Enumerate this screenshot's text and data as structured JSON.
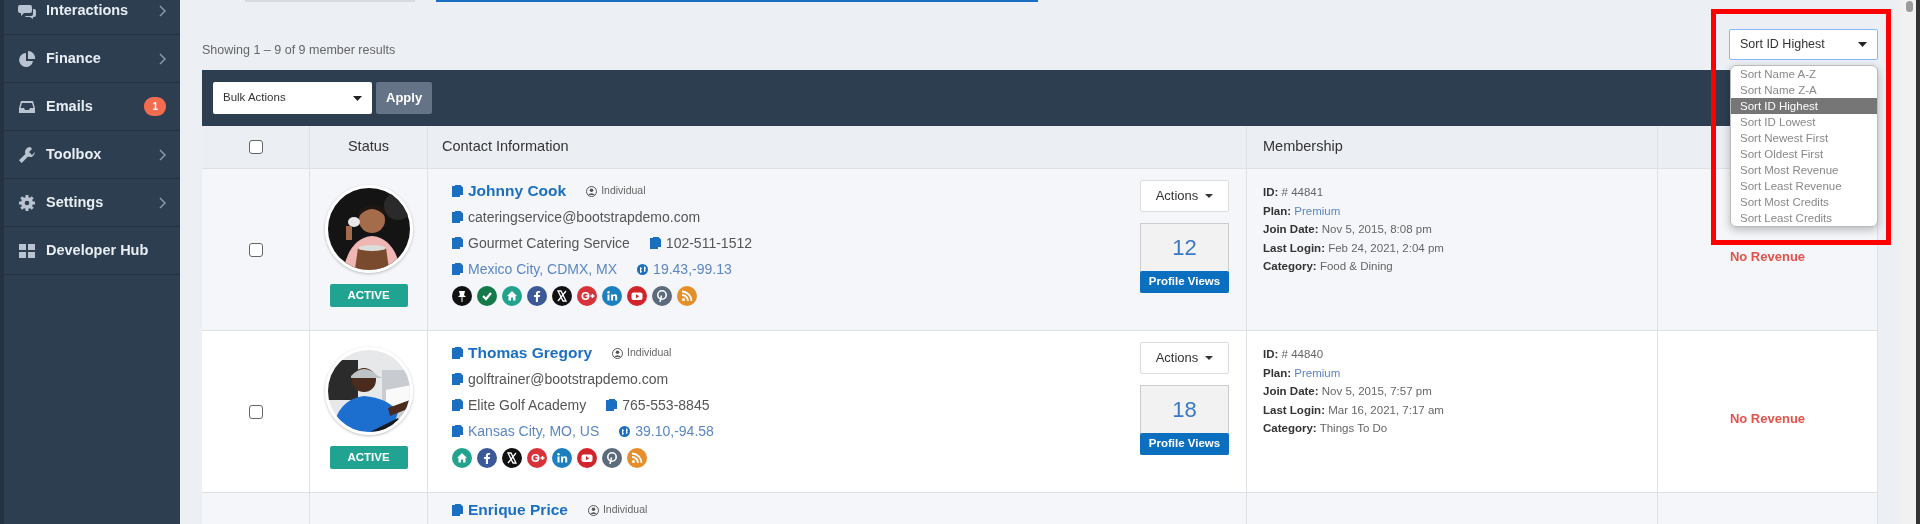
{
  "sidebar": {
    "items": [
      {
        "label": "Interactions",
        "kind": "chat",
        "submenu": true
      },
      {
        "label": "Finance",
        "kind": "pie",
        "submenu": true
      },
      {
        "label": "Emails",
        "kind": "inbox",
        "submenu": false,
        "badge": "1"
      },
      {
        "label": "Toolbox",
        "kind": "wrench",
        "submenu": true
      },
      {
        "label": "Settings",
        "kind": "gear",
        "submenu": true
      },
      {
        "label": "Developer Hub",
        "kind": "grid",
        "submenu": false
      }
    ]
  },
  "results_summary": "Showing 1 – 9 of 9 member results",
  "sort": {
    "value": "Sort ID Highest",
    "expanded": true,
    "options": [
      {
        "label": "Sort Name A-Z",
        "selected": false
      },
      {
        "label": "Sort Name Z-A",
        "selected": false
      },
      {
        "label": "Sort ID Highest",
        "selected": true
      },
      {
        "label": "Sort ID Lowest",
        "selected": false
      },
      {
        "label": "Sort Newest First",
        "selected": false
      },
      {
        "label": "Sort Oldest First",
        "selected": false
      },
      {
        "label": "Sort Most Revenue",
        "selected": false
      },
      {
        "label": "Sort Least Revenue",
        "selected": false
      },
      {
        "label": "Sort Most Credits",
        "selected": false
      },
      {
        "label": "Sort Least Credits",
        "selected": false
      }
    ]
  },
  "toolbar": {
    "bulk_actions": "Bulk Actions",
    "apply": "Apply"
  },
  "table": {
    "select_all": {
      "checked": false
    },
    "columns": [
      "Status",
      "Contact Information",
      "Membership"
    ],
    "rows": [
      {
        "selected": false,
        "status": "ACTIVE",
        "name": "Johnny Cook",
        "member_type": "Individual",
        "email": "cateringservice@bootstrapdemo.com",
        "company": "Gourmet Catering Service",
        "phone": "102-511-1512",
        "location": "Mexico City, CDMX, MX",
        "coordinates": "19.43,-99.13",
        "socials": [
          {
            "kind": "pin",
            "color": "#111111"
          },
          {
            "kind": "check",
            "color": "#157a4a"
          },
          {
            "kind": "home",
            "color": "#22a38d"
          },
          {
            "kind": "facebook",
            "color": "#3b5998"
          },
          {
            "kind": "x",
            "color": "#111111"
          },
          {
            "kind": "google",
            "color": "#d8333a"
          },
          {
            "kind": "linkedin",
            "color": "#1c7fc0"
          },
          {
            "kind": "youtube",
            "color": "#d4242b"
          },
          {
            "kind": "pinterest",
            "color": "#5b6b7c"
          },
          {
            "kind": "rss",
            "color": "#e58f2a"
          }
        ],
        "actions": "Actions",
        "profile_views": "12",
        "views_label": "Profile Views",
        "membership": [
          {
            "label": "ID:",
            "value": "# 44841",
            "kind": "plain"
          },
          {
            "label": "Plan:",
            "value": "Premium",
            "kind": "link"
          },
          {
            "label": "Join Date:",
            "value": "Nov 5, 2015, 8:08 pm",
            "kind": "plain"
          },
          {
            "label": "Last Login:",
            "value": "Feb 24, 2021, 2:04 pm",
            "kind": "plain"
          },
          {
            "label": "Category:",
            "value": "Food & Dining",
            "kind": "plain"
          }
        ],
        "revenue": "No Revenue"
      },
      {
        "selected": false,
        "status": "ACTIVE",
        "name": "Thomas Gregory",
        "member_type": "Individual",
        "email": "golftrainer@bootstrapdemo.com",
        "company": "Elite Golf Academy",
        "phone": "765-553-8845",
        "location": "Kansas City, MO, US",
        "coordinates": "39.10,-94.58",
        "socials": [
          {
            "kind": "home",
            "color": "#22a38d"
          },
          {
            "kind": "facebook",
            "color": "#3b5998"
          },
          {
            "kind": "x",
            "color": "#111111"
          },
          {
            "kind": "google",
            "color": "#d8333a"
          },
          {
            "kind": "linkedin",
            "color": "#1c7fc0"
          },
          {
            "kind": "youtube",
            "color": "#d4242b"
          },
          {
            "kind": "pinterest",
            "color": "#5b6b7c"
          },
          {
            "kind": "rss",
            "color": "#e58f2a"
          }
        ],
        "actions": "Actions",
        "profile_views": "18",
        "views_label": "Profile Views",
        "membership": [
          {
            "label": "ID:",
            "value": "# 44840",
            "kind": "plain"
          },
          {
            "label": "Plan:",
            "value": "Premium",
            "kind": "link"
          },
          {
            "label": "Join Date:",
            "value": "Nov 5, 2015, 7:57 pm",
            "kind": "plain"
          },
          {
            "label": "Last Login:",
            "value": "Mar 16, 2021, 7:17 am",
            "kind": "plain"
          },
          {
            "label": "Category:",
            "value": "Things To Do",
            "kind": "plain"
          }
        ],
        "revenue": "No Revenue"
      },
      {
        "name": "Enrique Price",
        "member_type": "Individual"
      }
    ]
  }
}
